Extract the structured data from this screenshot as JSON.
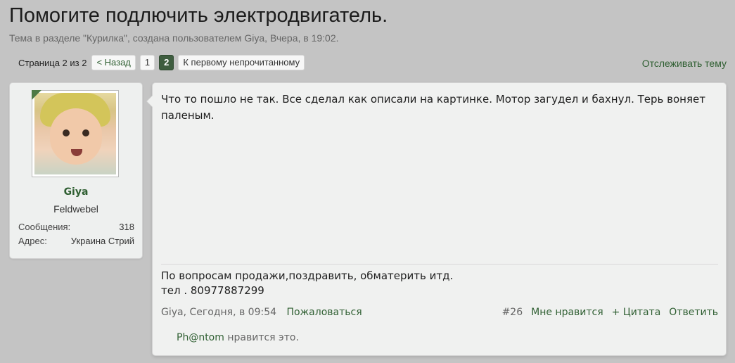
{
  "thread": {
    "title": "Помогите подлючить электродвигатель.",
    "subtitle": "Тема в разделе \"Курилка\", создана пользователем Giya, Вчера, в 19:02."
  },
  "pagination": {
    "page_info": "Страница 2 из 2",
    "prev_label": "< Назад",
    "pages": [
      "1",
      "2"
    ],
    "current_page": "2",
    "first_unread_label": "К первому непрочитанному"
  },
  "watch_label": "Отслеживать тему",
  "user": {
    "name": "Giya",
    "rank": "Feldwebel",
    "posts_label": "Сообщения:",
    "posts_value": "318",
    "location_label": "Адрес:",
    "location_value": "Украина Стрий"
  },
  "post": {
    "text": "Что то пошло не так. Все сделал как описали на картинке. Мотор загудел и бахнул. Терь воняет паленым.",
    "signature_line1": "По вопросам продажи,поздравить, обматерить итд.",
    "signature_line2": "тел . 80977887299",
    "author_time": "Giya, Сегодня, в 09:54",
    "report_label": "Пожаловаться",
    "post_number": "#26",
    "like_label": "Мне нравится",
    "quote_label": "+ Цитата",
    "reply_label": "Ответить",
    "liked_by": "Ph@ntom",
    "liked_suffix": "нравится это."
  },
  "colors": {
    "background": "#c4c4c4",
    "link_green": "#2f5f32",
    "current_page_bg": "#3e5d3f",
    "panel_bg": "#f0f1f0"
  }
}
